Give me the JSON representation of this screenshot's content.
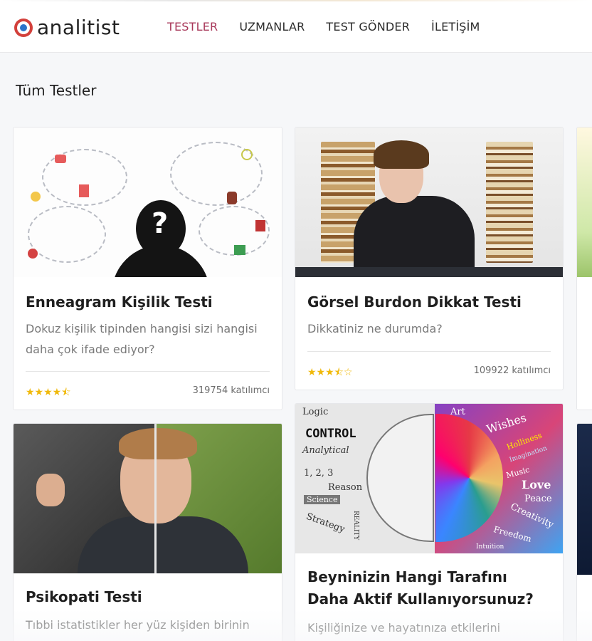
{
  "brand": {
    "name": "analitist"
  },
  "nav": {
    "items": [
      "TESTLER",
      "UZMANLAR",
      "TEST GÖNDER",
      "İLETİŞİM"
    ],
    "active_index": 0
  },
  "page": {
    "title": "Tüm Testler"
  },
  "cards": [
    {
      "title": "Enneagram Kişilik Testi",
      "description": "Dokuz kişilik tipinden hangisi sizi hangisi daha çok ifade ediyor?",
      "rating": 4.5,
      "stars": "★★★★⯪",
      "participants": "319754 katılımcı"
    },
    {
      "title": "Görsel Burdon Dikkat Testi",
      "description": "Dikkatiniz ne durumda?",
      "rating": 3.5,
      "stars": "★★★⯪☆",
      "participants": "109922 katılımcı"
    },
    {
      "title": "Psikopati Testi",
      "description": "Tıbbi istatistikler her yüz kişiden birinin"
    },
    {
      "title": "Beyninizin Hangi Tarafını Daha Aktif Kullanıyorsunuz?",
      "description": "Kişiliğinize ve hayatınıza etkilerini",
      "image_words": [
        "Logic",
        "CONTROL",
        "Analytical",
        "1, 2, 3",
        "Reason",
        "Science",
        "Strategy",
        "REALITY",
        "Art",
        "Wishes",
        "Holliness",
        "Imagination",
        "Music",
        "Love",
        "Peace",
        "Creativity",
        "Freedom",
        "Intuition"
      ]
    }
  ],
  "colors": {
    "accent": "#a8385a",
    "star": "#f0b90b",
    "muted_text": "#7a7a7a"
  }
}
